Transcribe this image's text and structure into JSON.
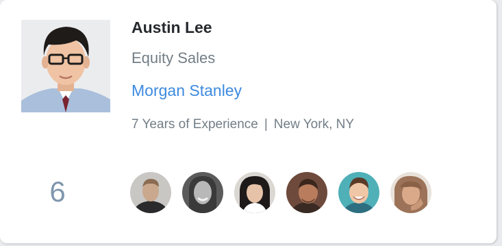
{
  "profile": {
    "name": "Austin Lee",
    "title": "Equity Sales",
    "company": "Morgan Stanley",
    "experience": "7 Years of Experience",
    "separator": "|",
    "location": "New York, NY"
  },
  "connections": {
    "count": "6",
    "avatars": [
      {
        "icon": "person-avatar-icon",
        "tone": "#c9a88e"
      },
      {
        "icon": "person-avatar-icon",
        "tone": "#9a9a9a"
      },
      {
        "icon": "person-avatar-icon",
        "tone": "#e6c3a8"
      },
      {
        "icon": "person-avatar-icon",
        "tone": "#b97d5e"
      },
      {
        "icon": "person-avatar-icon",
        "tone": "#f0c7a6"
      },
      {
        "icon": "person-avatar-icon",
        "tone": "#d9a98a"
      }
    ]
  },
  "colors": {
    "name": "#26292e",
    "secondary_text": "#727d86",
    "link": "#3d8ae0",
    "count": "#7f96ad",
    "card_bg": "#ffffff"
  }
}
